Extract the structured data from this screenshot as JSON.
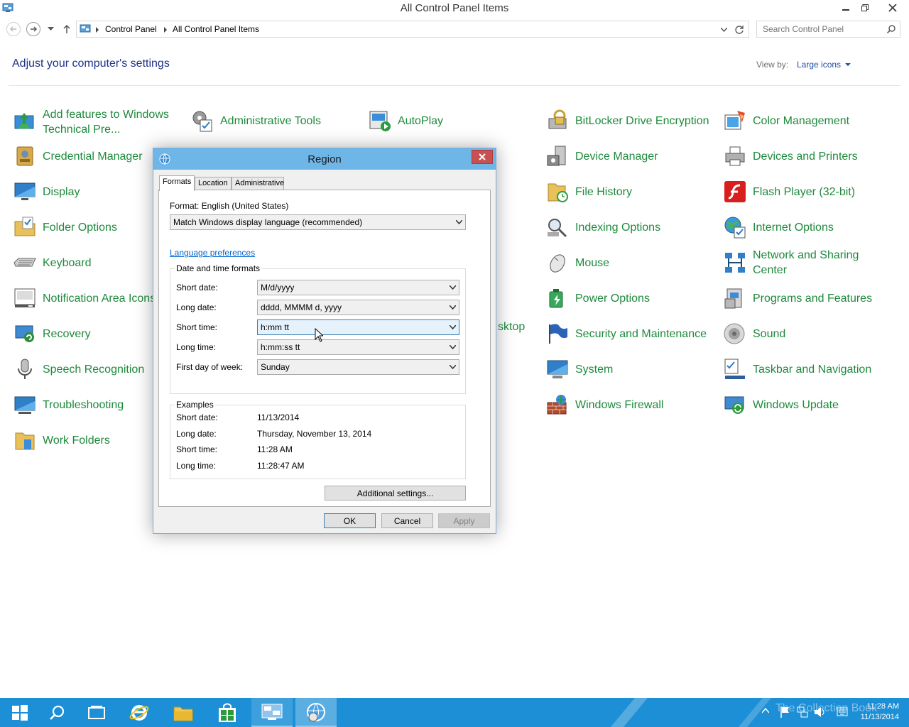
{
  "window": {
    "title": "All Control Panel Items"
  },
  "address": {
    "crumbs": [
      "Control Panel",
      "All Control Panel Items"
    ],
    "search_placeholder": "Search Control Panel"
  },
  "header": {
    "title": "Adjust your computer's settings",
    "view_by_label": "View by:",
    "view_by_value": "Large icons"
  },
  "items": {
    "add_features": "Add features to Windows Technical Pre...",
    "admin_tools": "Administrative Tools",
    "autoplay": "AutoPlay",
    "bitlocker": "BitLocker Drive Encryption",
    "color_mgmt": "Color Management",
    "credential": "Credential Manager",
    "device_mgr": "Device Manager",
    "devices_printers": "Devices and Printers",
    "display": "Display",
    "file_history": "File History",
    "flash": "Flash Player (32-bit)",
    "folder_options": "Folder Options",
    "indexing": "Indexing Options",
    "internet": "Internet Options",
    "keyboard": "Keyboard",
    "mouse": "Mouse",
    "network": "Network and Sharing Center",
    "notification": "Notification Area Icons",
    "power": "Power Options",
    "programs": "Programs and Features",
    "recovery": "Recovery",
    "desktop_partial": "sktop",
    "security": "Security and Maintenance",
    "sound": "Sound",
    "speech": "Speech Recognition",
    "system": "System",
    "taskbar_nav": "Taskbar and Navigation",
    "troubleshooting": "Troubleshooting",
    "firewall": "Windows Firewall",
    "update": "Windows Update",
    "work_folders": "Work Folders"
  },
  "dialog": {
    "title": "Region",
    "tabs": [
      "Formats",
      "Location",
      "Administrative"
    ],
    "format_label": "Format: English (United States)",
    "format_value": "Match Windows display language (recommended)",
    "language_link": "Language preferences",
    "dt_group": "Date and time formats",
    "fields": [
      {
        "label": "Short date:",
        "value": "M/d/yyyy"
      },
      {
        "label": "Long date:",
        "value": "dddd, MMMM d, yyyy"
      },
      {
        "label": "Short time:",
        "value": "h:mm tt"
      },
      {
        "label": "Long time:",
        "value": "h:mm:ss tt"
      },
      {
        "label": "First day of week:",
        "value": "Sunday"
      }
    ],
    "examples_group": "Examples",
    "examples": [
      {
        "label": "Short date:",
        "value": "11/13/2014"
      },
      {
        "label": "Long date:",
        "value": "Thursday, November 13, 2014"
      },
      {
        "label": "Short time:",
        "value": "11:28 AM"
      },
      {
        "label": "Long time:",
        "value": "11:28:47 AM"
      }
    ],
    "additional_btn": "Additional settings...",
    "ok": "OK",
    "cancel": "Cancel",
    "apply": "Apply"
  },
  "taskbar": {
    "time": "11:28 AM",
    "date": "11/13/2014",
    "watermark": "The Collection Book"
  },
  "colors": {
    "item_link": "#1e8a3c",
    "header_blue": "#1e3287",
    "taskbar": "#1c8fd6",
    "dialog_title": "#6fb6e8"
  }
}
